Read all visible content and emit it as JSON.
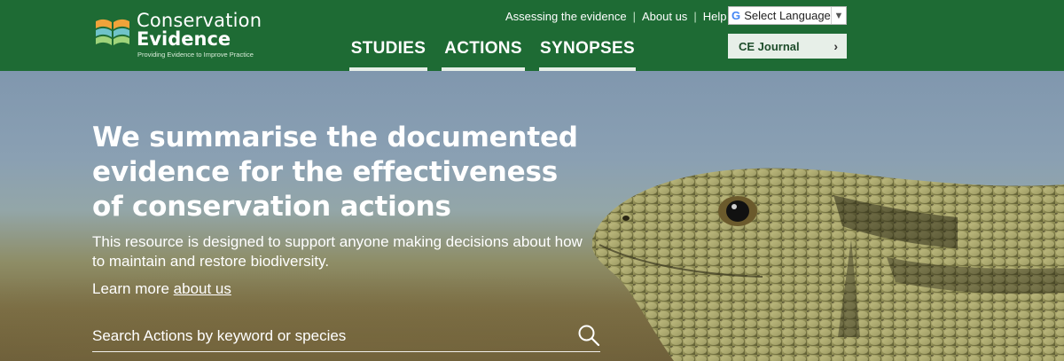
{
  "header": {
    "logo": {
      "title_line1": "Conservation",
      "title_line2": "Evidence",
      "tagline": "Providing Evidence to Improve Practice"
    },
    "top_links": [
      "Assessing the evidence",
      "About us",
      "Help"
    ],
    "nav": [
      "STUDIES",
      "ACTIONS",
      "SYNOPSES"
    ],
    "language_select": {
      "g": "G",
      "label": "Select Language",
      "arrow": "▼"
    },
    "journal_button": {
      "label": "CE Journal",
      "chevron": "›"
    }
  },
  "hero": {
    "headline": "We summarise the documented evidence for the effectiveness of conservation actions",
    "subtitle": "This resource is designed to support anyone making decisions about how to maintain and restore biodiversity.",
    "learn_prefix": "Learn more",
    "learn_link": "about us",
    "search_placeholder": "Search Actions by keyword or species"
  },
  "colors": {
    "header_bg": "#1e6b34",
    "nav_bar": "#e6eee7",
    "journal_bg": "#e7efe8",
    "logo_orange": "#f0a33a",
    "logo_teal": "#6fc3c9",
    "logo_green": "#9fd37a"
  },
  "icons": [
    "logo-book-icon",
    "google-g-icon",
    "dropdown-arrow-icon",
    "chevron-right-icon",
    "search-icon"
  ]
}
